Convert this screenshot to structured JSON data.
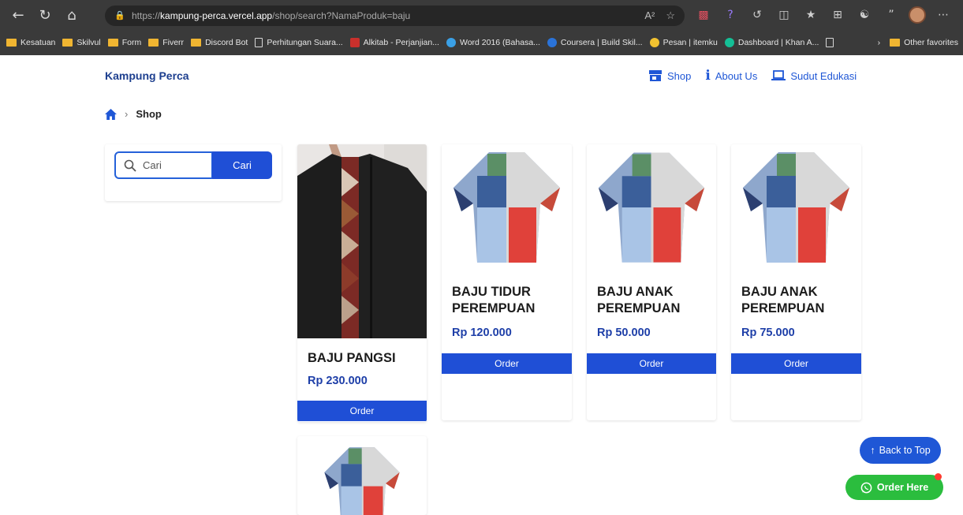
{
  "browser": {
    "url_prefix": "https://",
    "url_host": "kampung-perca.vercel.app",
    "url_path": "/shop/search?NamaProduk=baju",
    "read_aloud": "A²",
    "favorites_label": "Other favorites",
    "bookmarks": [
      {
        "label": "Kesatuan",
        "icon": "folder"
      },
      {
        "label": "Skilvul",
        "icon": "folder"
      },
      {
        "label": "Form",
        "icon": "folder"
      },
      {
        "label": "Fiverr",
        "icon": "folder"
      },
      {
        "label": "Discord Bot",
        "icon": "folder"
      },
      {
        "label": "Perhitungan Suara...",
        "icon": "page"
      },
      {
        "label": "Alkitab - Perjanjian...",
        "icon": "bible"
      },
      {
        "label": "Word 2016 (Bahasa...",
        "icon": "globe"
      },
      {
        "label": "Coursera | Build Skil...",
        "icon": "coursera"
      },
      {
        "label": "Pesan | itemku",
        "icon": "itemku"
      },
      {
        "label": "Dashboard | Khan A...",
        "icon": "khan"
      }
    ]
  },
  "site": {
    "brand": "Kampung Perca",
    "nav": [
      {
        "label": "Shop",
        "icon": "store-icon"
      },
      {
        "label": "About Us",
        "icon": "info-icon"
      },
      {
        "label": "Sudut Edukasi",
        "icon": "laptop-icon"
      }
    ]
  },
  "breadcrumb": {
    "current": "Shop"
  },
  "search": {
    "placeholder": "Cari",
    "button_label": "Cari"
  },
  "products": [
    {
      "name": "BAJU PANGSI",
      "price": "Rp 230.000",
      "order_label": "Order",
      "image": "jacket"
    },
    {
      "name": "BAJU TIDUR PEREMPUAN",
      "price": "Rp 120.000",
      "order_label": "Order",
      "image": "shirt"
    },
    {
      "name": "BAJU ANAK PEREMPUAN",
      "price": "Rp 50.000",
      "order_label": "Order",
      "image": "shirt"
    },
    {
      "name": "BAJU ANAK PEREMPUAN",
      "price": "Rp 75.000",
      "order_label": "Order",
      "image": "shirt"
    },
    {
      "name": "",
      "price": "",
      "order_label": "",
      "image": "shirt"
    }
  ],
  "floating": {
    "back_to_top": "Back to Top",
    "order_here": "Order Here"
  },
  "colors": {
    "brand_blue": "#1f4fd6",
    "whatsapp_green": "#2bbd3e"
  }
}
